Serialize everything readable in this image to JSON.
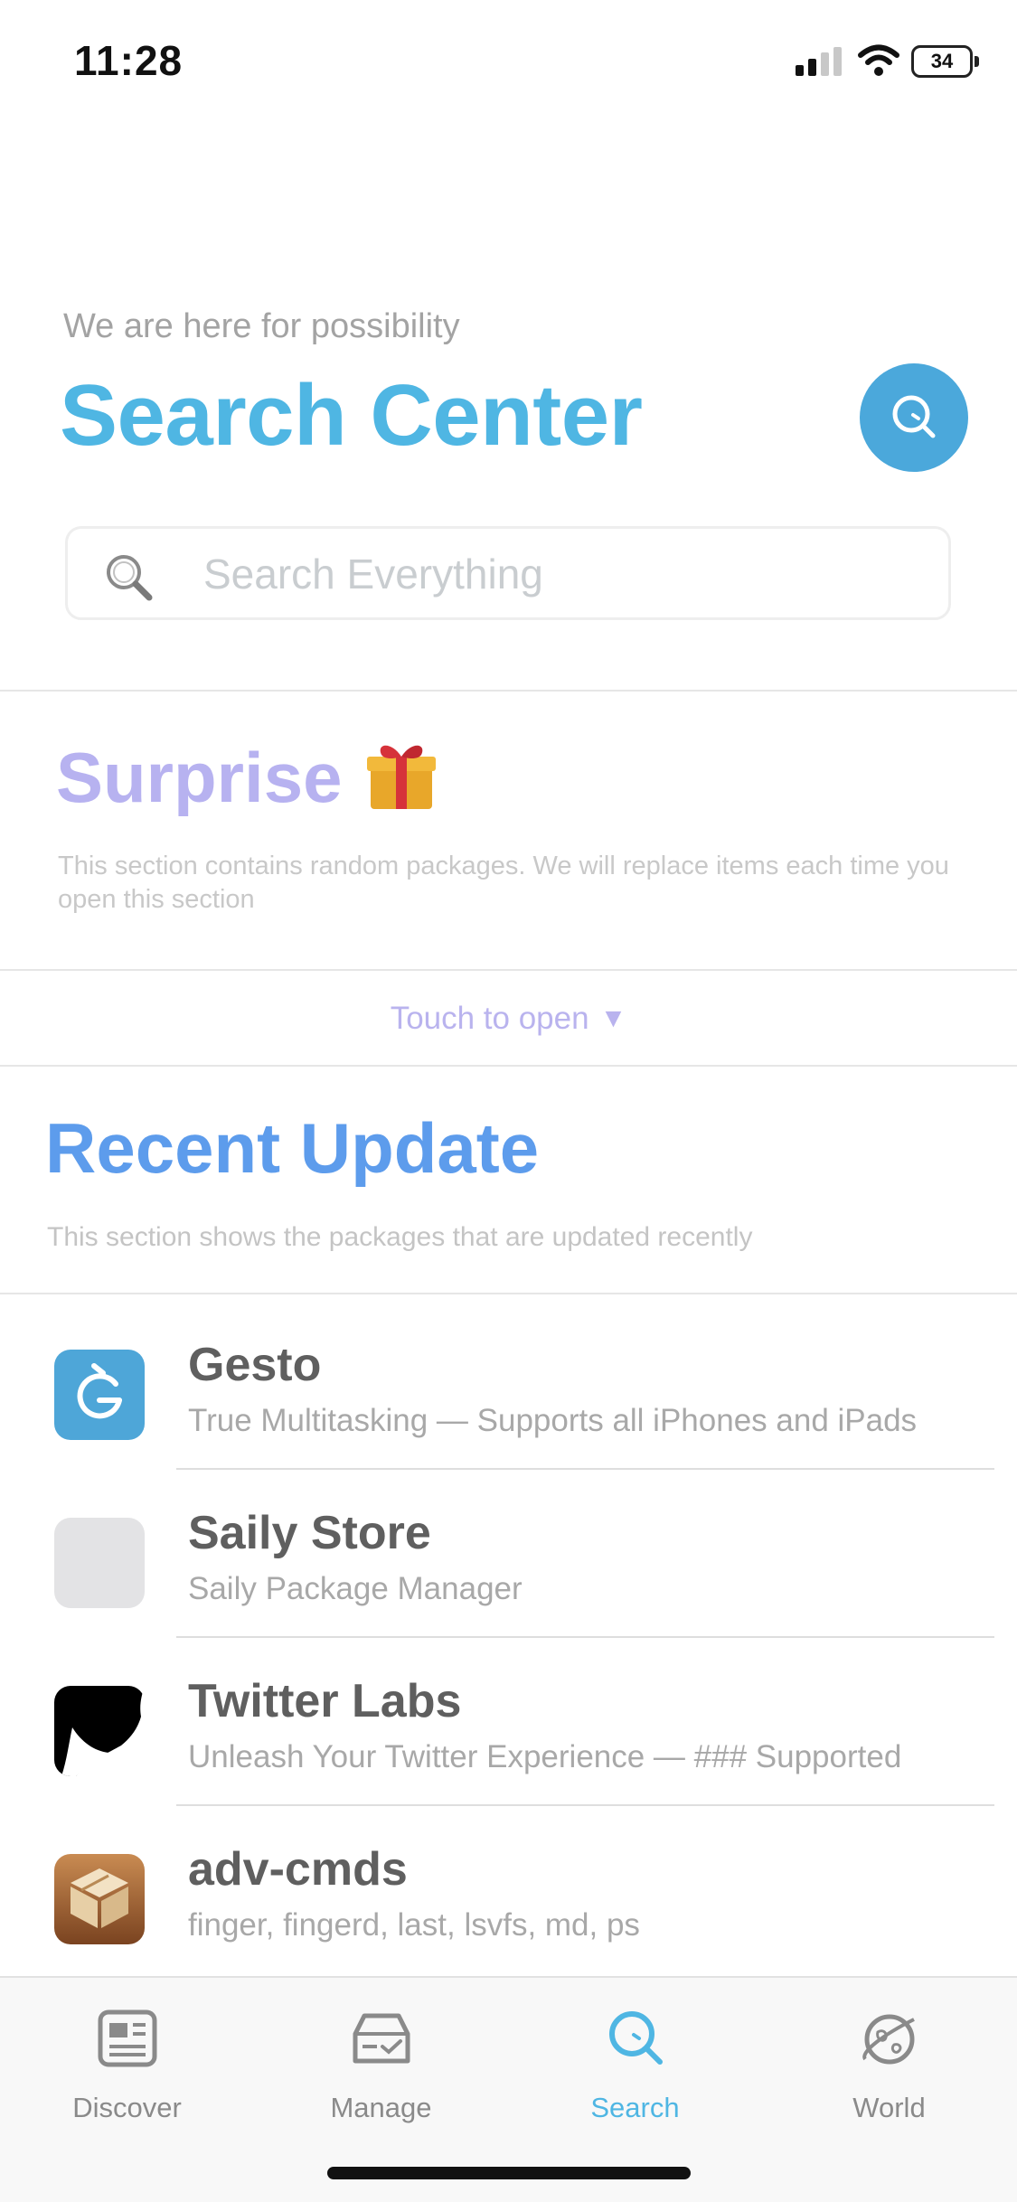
{
  "status_bar": {
    "time": "11:28",
    "battery": "34"
  },
  "header": {
    "subtitle": "We are here for possibility",
    "title": "Search Center",
    "search_button_icon": "search-icon"
  },
  "search": {
    "placeholder": "Search Everything",
    "value": ""
  },
  "surprise": {
    "title": "Surprise",
    "emoji_icon": "gift-icon",
    "description": "This section contains random packages. We will replace items each time you open this section",
    "touch_label": "Touch to open",
    "touch_arrow": "▼"
  },
  "recent": {
    "title": "Recent Update",
    "description": "This section shows the packages that are updated recently",
    "packages": [
      {
        "name": "Gesto",
        "description": "True Multitasking — Supports all iPhones and iPads",
        "icon": "gesto-icon"
      },
      {
        "name": "Saily Store",
        "description": "Saily Package Manager",
        "icon": "placeholder-icon"
      },
      {
        "name": "Twitter Labs",
        "description": "Unleash Your Twitter Experience — ### Supported",
        "icon": "twitter-labs-icon"
      },
      {
        "name": "adv-cmds",
        "description": "finger, fingerd, last, lsvfs, md, ps",
        "icon": "package-box-icon"
      }
    ]
  },
  "tabs": [
    {
      "label": "Discover",
      "icon": "newspaper-icon",
      "active": false
    },
    {
      "label": "Manage",
      "icon": "inbox-check-icon",
      "active": false
    },
    {
      "label": "Search",
      "icon": "search-icon",
      "active": true
    },
    {
      "label": "World",
      "icon": "planet-icon",
      "active": false
    }
  ],
  "colors": {
    "title_blue": "#4fb6e3",
    "accent_button": "#4ba8db",
    "surprise_purple": "#b7b2f0",
    "recent_blue": "#5d9cec"
  }
}
